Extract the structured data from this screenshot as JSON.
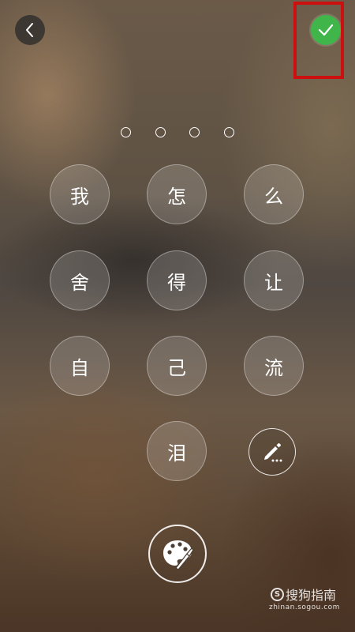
{
  "header": {
    "back_icon": "chevron-left-icon",
    "confirm_icon": "check-icon",
    "confirm_color": "#3fb54a",
    "highlight_color": "#cc1010"
  },
  "passcode": {
    "length": 4,
    "entered": 0
  },
  "keypad": {
    "keys": [
      "我",
      "怎",
      "么",
      "舍",
      "得",
      "让",
      "自",
      "己",
      "流",
      "泪"
    ],
    "edit_icon": "pencil-edit-icon"
  },
  "footer": {
    "palette_icon": "palette-icon"
  },
  "watermark": {
    "logo": "S",
    "brand": "搜狗指南",
    "url": "zhinan.sogou.com"
  }
}
